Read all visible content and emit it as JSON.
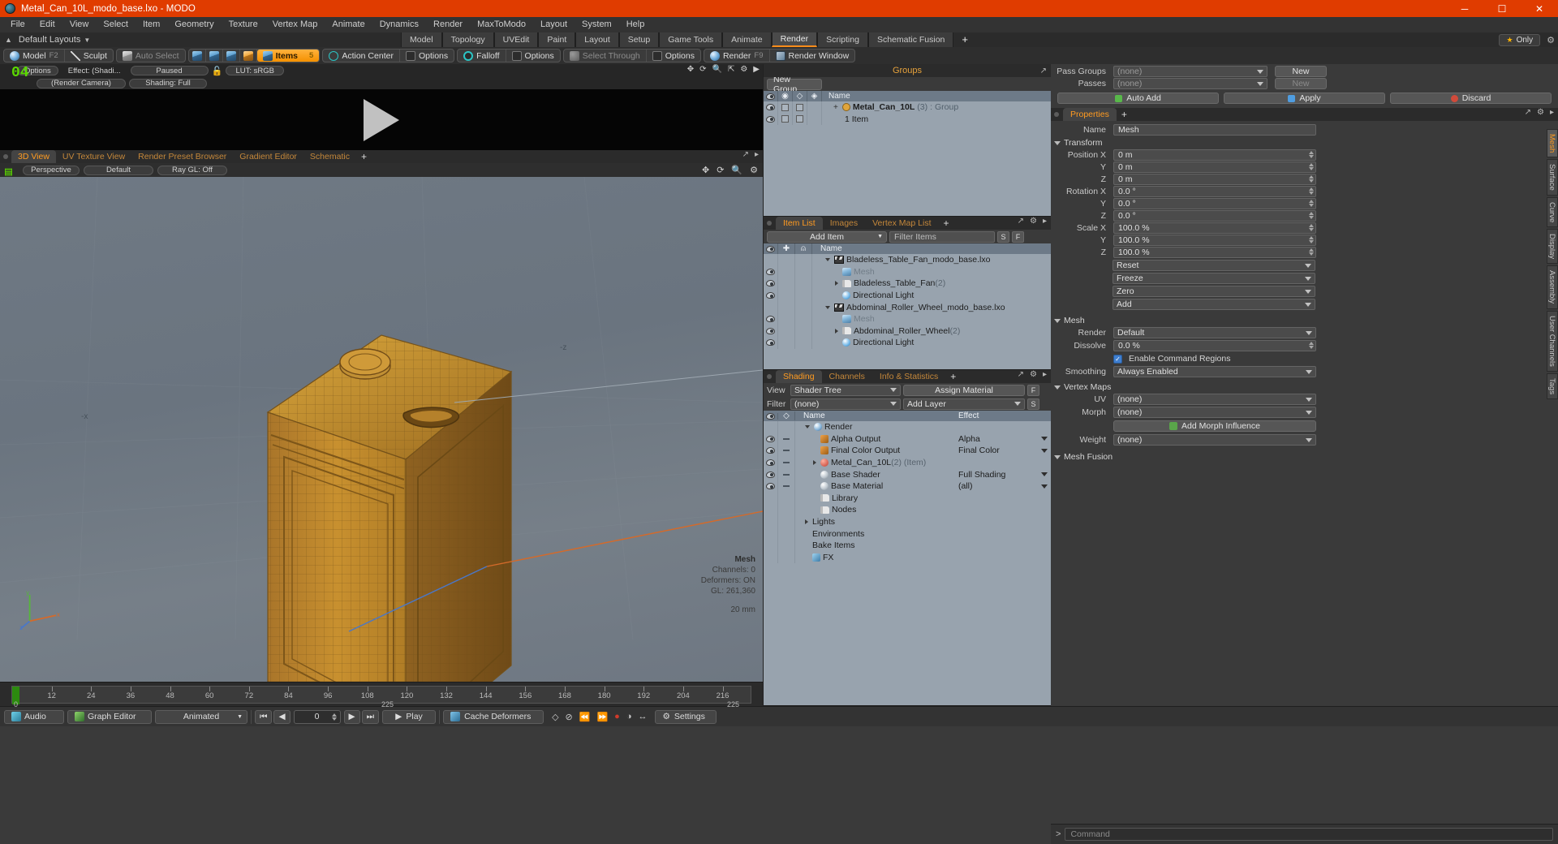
{
  "window": {
    "title": "Metal_Can_10L_modo_base.lxo - MODO",
    "minimize": "─",
    "maximize": "☐",
    "close": "✕"
  },
  "menubar": [
    "File",
    "Edit",
    "View",
    "Select",
    "Item",
    "Geometry",
    "Texture",
    "Vertex Map",
    "Animate",
    "Dynamics",
    "Render",
    "MaxToModo",
    "Layout",
    "System",
    "Help"
  ],
  "layout_row": {
    "layouts_label": "Default Layouts",
    "tabs": [
      "Model",
      "Topology",
      "UVEdit",
      "Paint",
      "Layout",
      "Setup",
      "Game Tools",
      "Animate",
      "Render",
      "Scripting",
      "Schematic Fusion"
    ],
    "selected_tab": "Render",
    "plus": "+",
    "only_label": "Only"
  },
  "toolbar": {
    "mode": [
      {
        "label": "Model",
        "key": "F2",
        "icon": "sphere-icon"
      },
      {
        "label": "Sculpt",
        "key": "",
        "icon": "pencil-icon"
      }
    ],
    "autoselect": "Auto Select",
    "selection_modes": [
      "vertex-mode-icon",
      "edge-mode-icon",
      "polygon-mode-icon",
      "material-mode-icon"
    ],
    "items_label": "Items",
    "items_key": "5",
    "action_center": "Action Center",
    "options1": "Options",
    "falloff": "Falloff",
    "options2": "Options",
    "select_through": "Select Through",
    "options3": "Options",
    "render": "Render",
    "render_key": "F9",
    "render_window": "Render Window"
  },
  "render_preview": {
    "overlay_marker": "04",
    "options": "Options",
    "effect": "Effect: (Shadi...",
    "paused": "Paused",
    "lut": "LUT: sRGB",
    "camera": "(Render Camera)",
    "shading": "Shading: Full",
    "icons": [
      "move-icon",
      "rotate-icon",
      "zoom-icon",
      "fit-icon",
      "gear-icon",
      "play-icon"
    ]
  },
  "viewport": {
    "tabs": [
      "3D View",
      "UV Texture View",
      "Render Preset Browser",
      "Gradient Editor",
      "Schematic"
    ],
    "selected_tab": "3D View",
    "plus": "+",
    "perspective": "Perspective",
    "shading_preset": "Default",
    "raygl": "Ray GL: Off",
    "axis_labels": {
      "neg_z": "-z",
      "neg_x": "-x",
      "y": "y",
      "z": "z",
      "x": "x"
    },
    "info": {
      "title": "Mesh",
      "channels": "Channels: 0",
      "deformers": "Deformers: ON",
      "gl": "GL: 261,360",
      "scale": "20 mm"
    }
  },
  "timeline": {
    "ticks": [
      12,
      24,
      36,
      48,
      60,
      72,
      84,
      96,
      108,
      120,
      132,
      144,
      156,
      168,
      180,
      192,
      204,
      216
    ],
    "start": "0",
    "mid": "225",
    "end": "225"
  },
  "groups_panel": {
    "title": "Groups",
    "new_group_button": "New Group",
    "columns": [
      "eye-icon",
      "render-icon",
      "wire-icon",
      "shade-icon",
      "Name"
    ],
    "rows": [
      {
        "name": "Metal_Can_10L",
        "count": "(3)",
        "type": ": Group",
        "indent": 1
      },
      {
        "name": "1 Item",
        "count": "",
        "type": "",
        "indent": 2
      }
    ]
  },
  "item_list": {
    "tabs": [
      "Item List",
      "Images",
      "Vertex Map List"
    ],
    "selected_tab": "Item List",
    "plus": "+",
    "add_item": "Add Item",
    "filter_placeholder": "Filter Items",
    "btn_s": "S",
    "btn_f": "F",
    "columns": [
      "eye-icon",
      "select-icon",
      "axis-icon",
      "Name"
    ],
    "rows": [
      {
        "name": "Bladeless_Table_Fan_modo_base.lxo",
        "count": "",
        "icon": "scene-icon",
        "indent": 1,
        "expander": "down",
        "eye": false
      },
      {
        "name": "Mesh",
        "count": "",
        "icon": "mesh-icon",
        "indent": 2,
        "expander": "",
        "eye": true,
        "dim": true
      },
      {
        "name": "Bladeless_Table_Fan",
        "count": "(2)",
        "icon": "folder-icon",
        "indent": 2,
        "expander": "right",
        "eye": true
      },
      {
        "name": "Directional Light",
        "count": "",
        "icon": "light-icon",
        "indent": 2,
        "expander": "",
        "eye": true
      },
      {
        "name": "Abdominal_Roller_Wheel_modo_base.lxo",
        "count": "",
        "icon": "scene-icon",
        "indent": 1,
        "expander": "down",
        "eye": false
      },
      {
        "name": "Mesh",
        "count": "",
        "icon": "mesh-icon",
        "indent": 2,
        "expander": "",
        "eye": true,
        "dim": true
      },
      {
        "name": "Abdominal_Roller_Wheel",
        "count": "(2)",
        "icon": "folder-icon",
        "indent": 2,
        "expander": "right",
        "eye": true
      },
      {
        "name": "Directional Light",
        "count": "",
        "icon": "light-icon",
        "indent": 2,
        "expander": "",
        "eye": true
      }
    ]
  },
  "shading_panel": {
    "tabs": [
      "Shading",
      "Channels",
      "Info & Statistics"
    ],
    "selected_tab": "Shading",
    "plus": "+",
    "view_label": "View",
    "view_value": "Shader Tree",
    "assign_material": "Assign Material",
    "btn_f": "F",
    "filter_label": "Filter",
    "filter_value": "(none)",
    "add_layer": "Add Layer",
    "btn_s": "S",
    "columns": [
      "eye-icon",
      "link-icon",
      "Name",
      "Effect"
    ],
    "rows": [
      {
        "name": "Render",
        "effect": "",
        "indent": 1,
        "expander": "down",
        "icon": "render-icon",
        "eye": false
      },
      {
        "name": "Alpha Output",
        "effect": "Alpha",
        "indent": 2,
        "expander": "",
        "icon": "output-icon",
        "eye": true
      },
      {
        "name": "Final Color Output",
        "effect": "Final Color",
        "indent": 2,
        "expander": "",
        "icon": "output-icon",
        "eye": true
      },
      {
        "name": "Metal_Can_10L",
        "count": "(2) (Item)",
        "effect": "",
        "indent": 2,
        "expander": "right",
        "icon": "material-icon",
        "eye": true
      },
      {
        "name": "Base Shader",
        "effect": "Full Shading",
        "indent": 2,
        "expander": "",
        "icon": "shader-icon",
        "eye": true
      },
      {
        "name": "Base Material",
        "effect": "(all)",
        "indent": 2,
        "expander": "",
        "icon": "shader-icon",
        "eye": true
      },
      {
        "name": "Library",
        "effect": "",
        "indent": 2,
        "expander": "",
        "icon": "folder-icon",
        "eye": false
      },
      {
        "name": "Nodes",
        "effect": "",
        "indent": 2,
        "expander": "",
        "icon": "folder-icon",
        "eye": false
      },
      {
        "name": "Lights",
        "effect": "",
        "indent": 1,
        "expander": "right",
        "icon": "",
        "eye": false
      },
      {
        "name": "Environments",
        "effect": "",
        "indent": 1,
        "expander": "",
        "icon": "",
        "eye": false
      },
      {
        "name": "Bake Items",
        "effect": "",
        "indent": 1,
        "expander": "",
        "icon": "",
        "eye": false
      },
      {
        "name": "FX",
        "effect": "",
        "indent": 1,
        "expander": "",
        "icon": "fx-icon",
        "eye": false
      }
    ]
  },
  "properties": {
    "pass_groups_label": "Pass Groups",
    "pass_groups_value": "(none)",
    "new_button": "New",
    "passes_label": "Passes",
    "passes_value": "(none)",
    "new_button2": "New",
    "auto_add": "Auto Add",
    "apply": "Apply",
    "discard": "Discard",
    "tab": "Properties",
    "plus": "+",
    "name_label": "Name",
    "name_value": "Mesh",
    "transform_section": "Transform",
    "position": {
      "label": "Position",
      "axes": [
        "X",
        "Y",
        "Z"
      ],
      "values": [
        "0 m",
        "0 m",
        "0 m"
      ]
    },
    "rotation": {
      "label": "Rotation",
      "axes": [
        "X",
        "Y",
        "Z"
      ],
      "values": [
        "0.0 °",
        "0.0 °",
        "0.0 °"
      ]
    },
    "scale": {
      "label": "Scale",
      "axes": [
        "X",
        "Y",
        "Z"
      ],
      "values": [
        "100.0 %",
        "100.0 %",
        "100.0 %"
      ]
    },
    "transform_buttons": [
      "Reset",
      "Freeze",
      "Zero",
      "Add"
    ],
    "mesh_section": "Mesh",
    "render_label": "Render",
    "render_value": "Default",
    "dissolve_label": "Dissolve",
    "dissolve_value": "0.0 %",
    "enable_command_regions": "Enable Command Regions",
    "smoothing_label": "Smoothing",
    "smoothing_value": "Always Enabled",
    "vertex_maps_section": "Vertex Maps",
    "uv_label": "UV",
    "uv_value": "(none)",
    "morph_label": "Morph",
    "morph_value": "(none)",
    "add_morph_influence": "Add Morph Influence",
    "weight_label": "Weight",
    "weight_value": "(none)",
    "mesh_fusion_section": "Mesh Fusion",
    "vertical_tabs": [
      "Mesh",
      "Surface",
      "Curve",
      "Display",
      "Assembly",
      "User Channels",
      "Tags"
    ],
    "vertical_selected": "Mesh"
  },
  "bottom_bar": {
    "audio": "Audio",
    "graph_editor": "Graph Editor",
    "animated": "Animated",
    "frame_value": "0",
    "play": "Play",
    "cache_deformers": "Cache Deformers",
    "settings": "Settings",
    "transport": [
      "skip-start-icon",
      "step-back-icon",
      "step-forward-icon",
      "skip-end-icon"
    ],
    "record_icons": [
      "key-icon",
      "nokey-icon",
      "prev-key-icon",
      "next-key-icon",
      "record-icon",
      "ghost-icon",
      "range-icon"
    ],
    "command_placeholder": "Command",
    "command_prompt": ">"
  }
}
